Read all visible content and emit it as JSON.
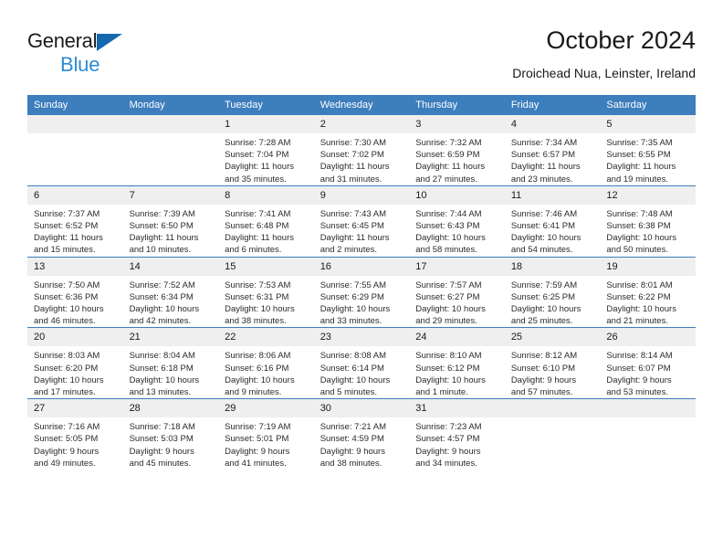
{
  "logo": {
    "word1": "General",
    "word2": "Blue",
    "triangle_color": "#1568b0",
    "word2_color": "#2b8bd4"
  },
  "header": {
    "title": "October 2024",
    "subtitle": "Droichead Nua, Leinster, Ireland",
    "header_bg": "#3d7ebd",
    "daynum_bg": "#efefef"
  },
  "weekday_headers": [
    "Sunday",
    "Monday",
    "Tuesday",
    "Wednesday",
    "Thursday",
    "Friday",
    "Saturday"
  ],
  "weeks": [
    [
      {
        "day": "",
        "blank": true,
        "sunrise": "",
        "sunset": "",
        "daylight1": "",
        "daylight2": ""
      },
      {
        "day": "",
        "blank": true,
        "sunrise": "",
        "sunset": "",
        "daylight1": "",
        "daylight2": ""
      },
      {
        "day": "1",
        "blank": false,
        "sunrise": "Sunrise: 7:28 AM",
        "sunset": "Sunset: 7:04 PM",
        "daylight1": "Daylight: 11 hours",
        "daylight2": "and 35 minutes."
      },
      {
        "day": "2",
        "blank": false,
        "sunrise": "Sunrise: 7:30 AM",
        "sunset": "Sunset: 7:02 PM",
        "daylight1": "Daylight: 11 hours",
        "daylight2": "and 31 minutes."
      },
      {
        "day": "3",
        "blank": false,
        "sunrise": "Sunrise: 7:32 AM",
        "sunset": "Sunset: 6:59 PM",
        "daylight1": "Daylight: 11 hours",
        "daylight2": "and 27 minutes."
      },
      {
        "day": "4",
        "blank": false,
        "sunrise": "Sunrise: 7:34 AM",
        "sunset": "Sunset: 6:57 PM",
        "daylight1": "Daylight: 11 hours",
        "daylight2": "and 23 minutes."
      },
      {
        "day": "5",
        "blank": false,
        "sunrise": "Sunrise: 7:35 AM",
        "sunset": "Sunset: 6:55 PM",
        "daylight1": "Daylight: 11 hours",
        "daylight2": "and 19 minutes."
      }
    ],
    [
      {
        "day": "6",
        "blank": false,
        "sunrise": "Sunrise: 7:37 AM",
        "sunset": "Sunset: 6:52 PM",
        "daylight1": "Daylight: 11 hours",
        "daylight2": "and 15 minutes."
      },
      {
        "day": "7",
        "blank": false,
        "sunrise": "Sunrise: 7:39 AM",
        "sunset": "Sunset: 6:50 PM",
        "daylight1": "Daylight: 11 hours",
        "daylight2": "and 10 minutes."
      },
      {
        "day": "8",
        "blank": false,
        "sunrise": "Sunrise: 7:41 AM",
        "sunset": "Sunset: 6:48 PM",
        "daylight1": "Daylight: 11 hours",
        "daylight2": "and 6 minutes."
      },
      {
        "day": "9",
        "blank": false,
        "sunrise": "Sunrise: 7:43 AM",
        "sunset": "Sunset: 6:45 PM",
        "daylight1": "Daylight: 11 hours",
        "daylight2": "and 2 minutes."
      },
      {
        "day": "10",
        "blank": false,
        "sunrise": "Sunrise: 7:44 AM",
        "sunset": "Sunset: 6:43 PM",
        "daylight1": "Daylight: 10 hours",
        "daylight2": "and 58 minutes."
      },
      {
        "day": "11",
        "blank": false,
        "sunrise": "Sunrise: 7:46 AM",
        "sunset": "Sunset: 6:41 PM",
        "daylight1": "Daylight: 10 hours",
        "daylight2": "and 54 minutes."
      },
      {
        "day": "12",
        "blank": false,
        "sunrise": "Sunrise: 7:48 AM",
        "sunset": "Sunset: 6:38 PM",
        "daylight1": "Daylight: 10 hours",
        "daylight2": "and 50 minutes."
      }
    ],
    [
      {
        "day": "13",
        "blank": false,
        "sunrise": "Sunrise: 7:50 AM",
        "sunset": "Sunset: 6:36 PM",
        "daylight1": "Daylight: 10 hours",
        "daylight2": "and 46 minutes."
      },
      {
        "day": "14",
        "blank": false,
        "sunrise": "Sunrise: 7:52 AM",
        "sunset": "Sunset: 6:34 PM",
        "daylight1": "Daylight: 10 hours",
        "daylight2": "and 42 minutes."
      },
      {
        "day": "15",
        "blank": false,
        "sunrise": "Sunrise: 7:53 AM",
        "sunset": "Sunset: 6:31 PM",
        "daylight1": "Daylight: 10 hours",
        "daylight2": "and 38 minutes."
      },
      {
        "day": "16",
        "blank": false,
        "sunrise": "Sunrise: 7:55 AM",
        "sunset": "Sunset: 6:29 PM",
        "daylight1": "Daylight: 10 hours",
        "daylight2": "and 33 minutes."
      },
      {
        "day": "17",
        "blank": false,
        "sunrise": "Sunrise: 7:57 AM",
        "sunset": "Sunset: 6:27 PM",
        "daylight1": "Daylight: 10 hours",
        "daylight2": "and 29 minutes."
      },
      {
        "day": "18",
        "blank": false,
        "sunrise": "Sunrise: 7:59 AM",
        "sunset": "Sunset: 6:25 PM",
        "daylight1": "Daylight: 10 hours",
        "daylight2": "and 25 minutes."
      },
      {
        "day": "19",
        "blank": false,
        "sunrise": "Sunrise: 8:01 AM",
        "sunset": "Sunset: 6:22 PM",
        "daylight1": "Daylight: 10 hours",
        "daylight2": "and 21 minutes."
      }
    ],
    [
      {
        "day": "20",
        "blank": false,
        "sunrise": "Sunrise: 8:03 AM",
        "sunset": "Sunset: 6:20 PM",
        "daylight1": "Daylight: 10 hours",
        "daylight2": "and 17 minutes."
      },
      {
        "day": "21",
        "blank": false,
        "sunrise": "Sunrise: 8:04 AM",
        "sunset": "Sunset: 6:18 PM",
        "daylight1": "Daylight: 10 hours",
        "daylight2": "and 13 minutes."
      },
      {
        "day": "22",
        "blank": false,
        "sunrise": "Sunrise: 8:06 AM",
        "sunset": "Sunset: 6:16 PM",
        "daylight1": "Daylight: 10 hours",
        "daylight2": "and 9 minutes."
      },
      {
        "day": "23",
        "blank": false,
        "sunrise": "Sunrise: 8:08 AM",
        "sunset": "Sunset: 6:14 PM",
        "daylight1": "Daylight: 10 hours",
        "daylight2": "and 5 minutes."
      },
      {
        "day": "24",
        "blank": false,
        "sunrise": "Sunrise: 8:10 AM",
        "sunset": "Sunset: 6:12 PM",
        "daylight1": "Daylight: 10 hours",
        "daylight2": "and 1 minute."
      },
      {
        "day": "25",
        "blank": false,
        "sunrise": "Sunrise: 8:12 AM",
        "sunset": "Sunset: 6:10 PM",
        "daylight1": "Daylight: 9 hours",
        "daylight2": "and 57 minutes."
      },
      {
        "day": "26",
        "blank": false,
        "sunrise": "Sunrise: 8:14 AM",
        "sunset": "Sunset: 6:07 PM",
        "daylight1": "Daylight: 9 hours",
        "daylight2": "and 53 minutes."
      }
    ],
    [
      {
        "day": "27",
        "blank": false,
        "sunrise": "Sunrise: 7:16 AM",
        "sunset": "Sunset: 5:05 PM",
        "daylight1": "Daylight: 9 hours",
        "daylight2": "and 49 minutes."
      },
      {
        "day": "28",
        "blank": false,
        "sunrise": "Sunrise: 7:18 AM",
        "sunset": "Sunset: 5:03 PM",
        "daylight1": "Daylight: 9 hours",
        "daylight2": "and 45 minutes."
      },
      {
        "day": "29",
        "blank": false,
        "sunrise": "Sunrise: 7:19 AM",
        "sunset": "Sunset: 5:01 PM",
        "daylight1": "Daylight: 9 hours",
        "daylight2": "and 41 minutes."
      },
      {
        "day": "30",
        "blank": false,
        "sunrise": "Sunrise: 7:21 AM",
        "sunset": "Sunset: 4:59 PM",
        "daylight1": "Daylight: 9 hours",
        "daylight2": "and 38 minutes."
      },
      {
        "day": "31",
        "blank": false,
        "sunrise": "Sunrise: 7:23 AM",
        "sunset": "Sunset: 4:57 PM",
        "daylight1": "Daylight: 9 hours",
        "daylight2": "and 34 minutes."
      },
      {
        "day": "",
        "blank": true,
        "sunrise": "",
        "sunset": "",
        "daylight1": "",
        "daylight2": ""
      },
      {
        "day": "",
        "blank": true,
        "sunrise": "",
        "sunset": "",
        "daylight1": "",
        "daylight2": ""
      }
    ]
  ]
}
